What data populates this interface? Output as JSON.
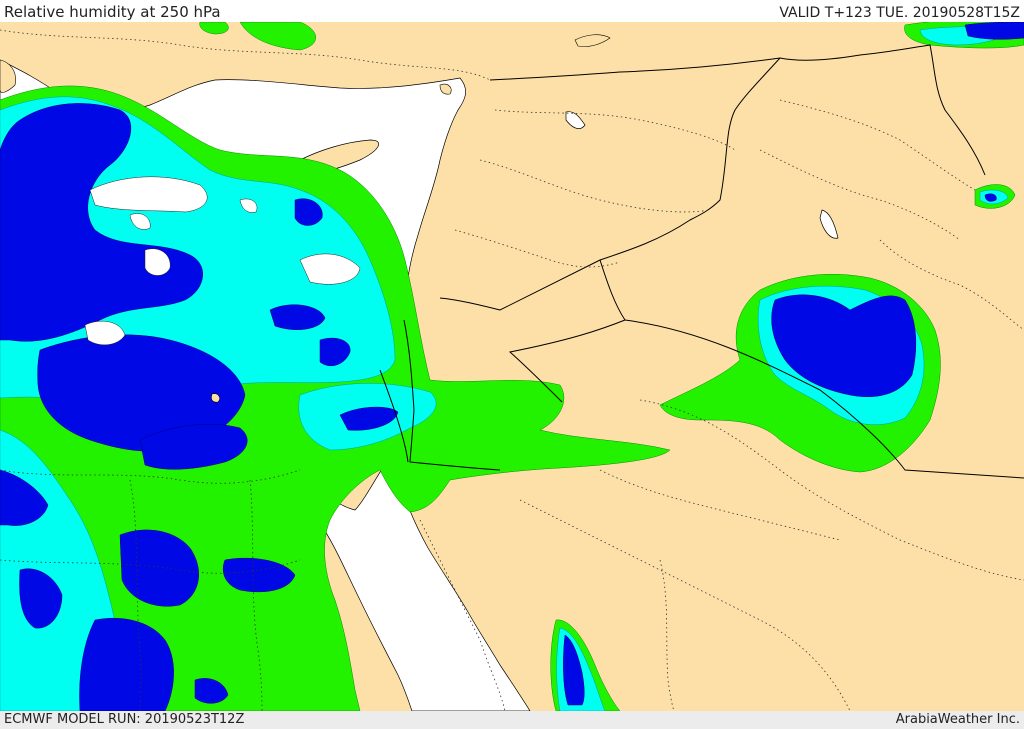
{
  "header": {
    "title": "Relative humidity at 250 hPa",
    "valid": "VALID T+123 TUE. 20190528T15Z"
  },
  "footer": {
    "model_run": "ECMWF MODEL RUN: 20190523T12Z",
    "credit": "ArabiaWeather Inc."
  },
  "colors": {
    "land": "#fde0a8",
    "sea": "#ffffff",
    "rh_low": "#22f200",
    "rh_mid": "#00fff0",
    "rh_high": "#0008e6",
    "border": "#000000"
  }
}
